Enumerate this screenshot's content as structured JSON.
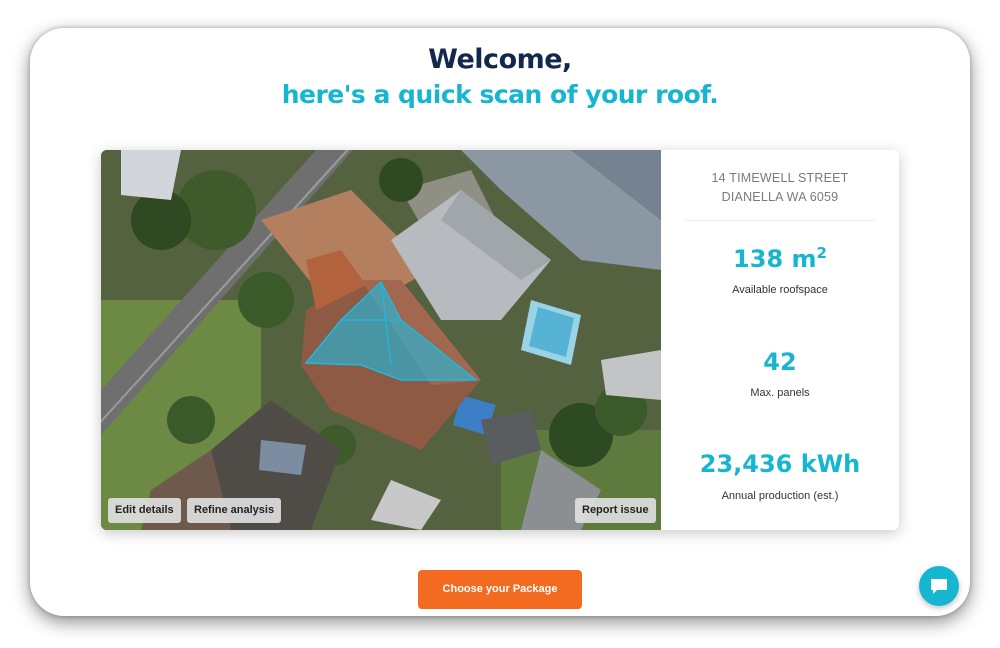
{
  "header": {
    "line1": "Welcome,",
    "line2": "here's a quick scan of your roof."
  },
  "map": {
    "buttons": {
      "edit": "Edit details",
      "refine": "Refine analysis",
      "report": "Report issue"
    }
  },
  "stats": {
    "address_line1": "14 TIMEWELL STREET",
    "address_line2": "DIANELLA WA 6059",
    "roofspace_value": "138 m",
    "roofspace_unit_sup": "2",
    "roofspace_label": "Available roofspace",
    "panels_value": "42",
    "panels_label": "Max. panels",
    "production_value": "23,436 kWh",
    "production_label": "Annual production (est.)"
  },
  "cta": {
    "label": "Choose your Package"
  },
  "icons": {
    "chat": "chat-bubble-icon"
  },
  "colors": {
    "navy": "#13294b",
    "accent": "#17b6d0",
    "cta": "#f26b21"
  }
}
